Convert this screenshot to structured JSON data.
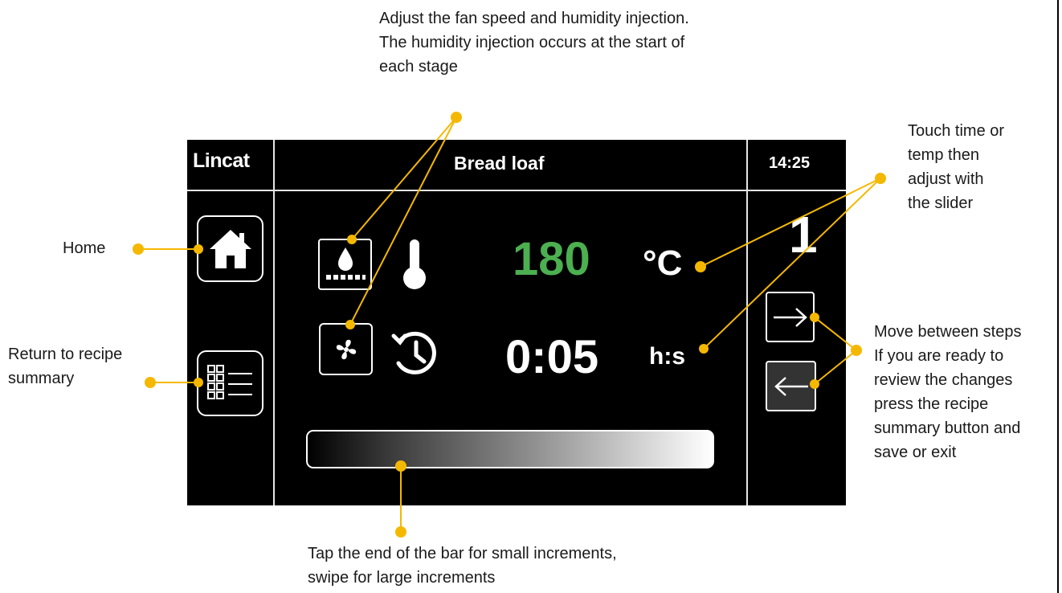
{
  "header": {
    "brand": "Lincat",
    "recipe_title": "Bread loaf",
    "clock": "14:25"
  },
  "stage": {
    "step_number": "1",
    "temperature": {
      "value": "180",
      "unit": "°C"
    },
    "time": {
      "value": "0:05",
      "unit": "h:s"
    },
    "slider_level": 1.0
  },
  "annotations": {
    "top_line1": "Adjust the fan speed and humidity injection.",
    "top_line2": "The humidity injection occurs at the start of",
    "top_line3": "each stage",
    "touch_line1": "Touch time or",
    "touch_line2": "temp then",
    "touch_line3": "adjust with",
    "touch_line4": "the slider",
    "home": "Home",
    "summary_line1": "Return to recipe",
    "summary_line2": "summary",
    "move_line1": "Move between steps",
    "move_line2": "If you are ready to",
    "move_line3": "review the changes",
    "move_line4": "press the recipe",
    "move_line5": "summary button and",
    "move_line6": "save or exit",
    "bottom_line1": "Tap the end of the bar for small increments,",
    "bottom_line2": "swipe for large increments"
  },
  "icons": {
    "home": "home-icon",
    "recipe_summary": "grid-list-icon",
    "humidity": "water-drop-icon",
    "temperature": "thermometer-icon",
    "fan": "fan-icon",
    "timer": "clock-icon",
    "next": "arrow-right-icon",
    "previous": "arrow-left-icon"
  },
  "colors": {
    "screen_bg": "#000000",
    "temperature_text": "#4caf50",
    "callout": "#f5b800",
    "divider": "#e6e6e6"
  }
}
